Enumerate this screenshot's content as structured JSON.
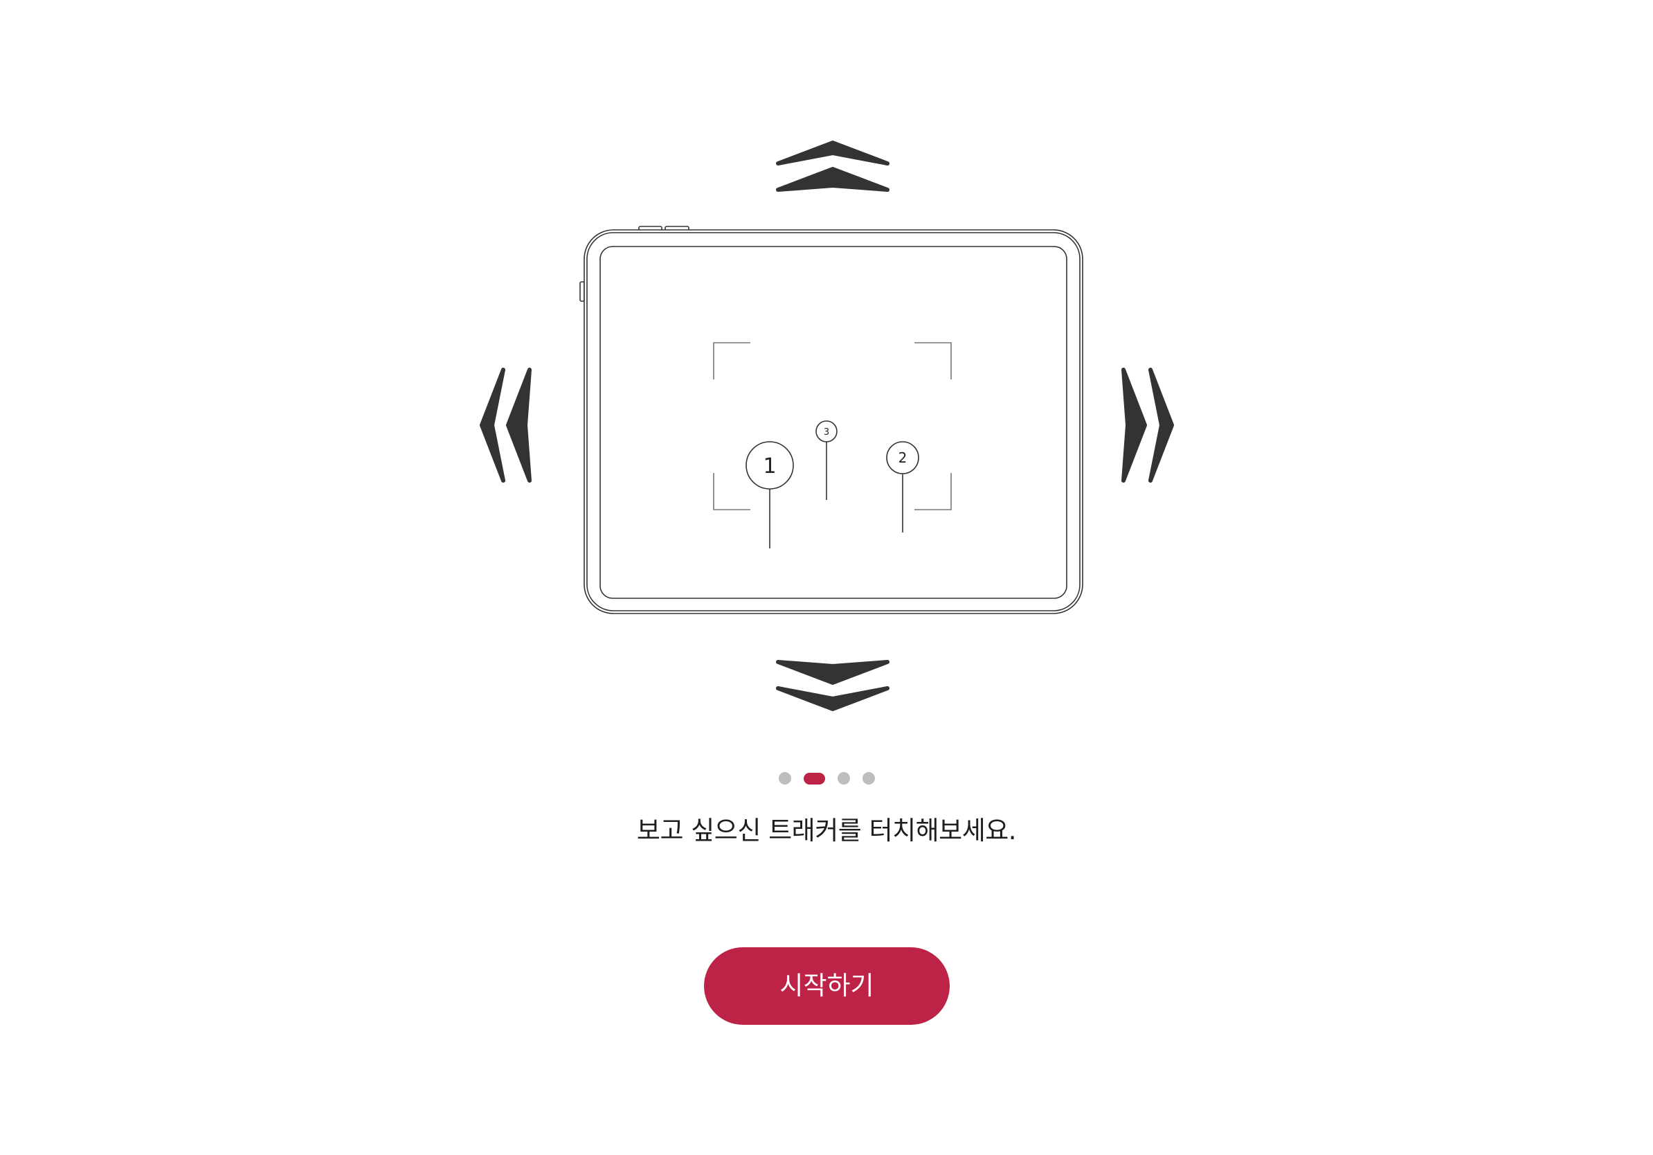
{
  "illustration": {
    "markers": [
      {
        "label": "1"
      },
      {
        "label": "3"
      },
      {
        "label": "2"
      }
    ],
    "icons": [
      "arrow-up-icon",
      "arrow-down-icon",
      "arrow-left-icon",
      "arrow-right-icon",
      "tablet-icon"
    ]
  },
  "pagination": {
    "total": 4,
    "active_index": 1
  },
  "instruction": "보고 싶으신 트래커를 터치해보세요.",
  "start_button": {
    "label": "시작하기"
  },
  "colors": {
    "accent": "#BC2347",
    "dot_inactive": "#BDBDBD",
    "arrow": "#333333",
    "outline": "#333333",
    "background": "#FFFFFF"
  }
}
